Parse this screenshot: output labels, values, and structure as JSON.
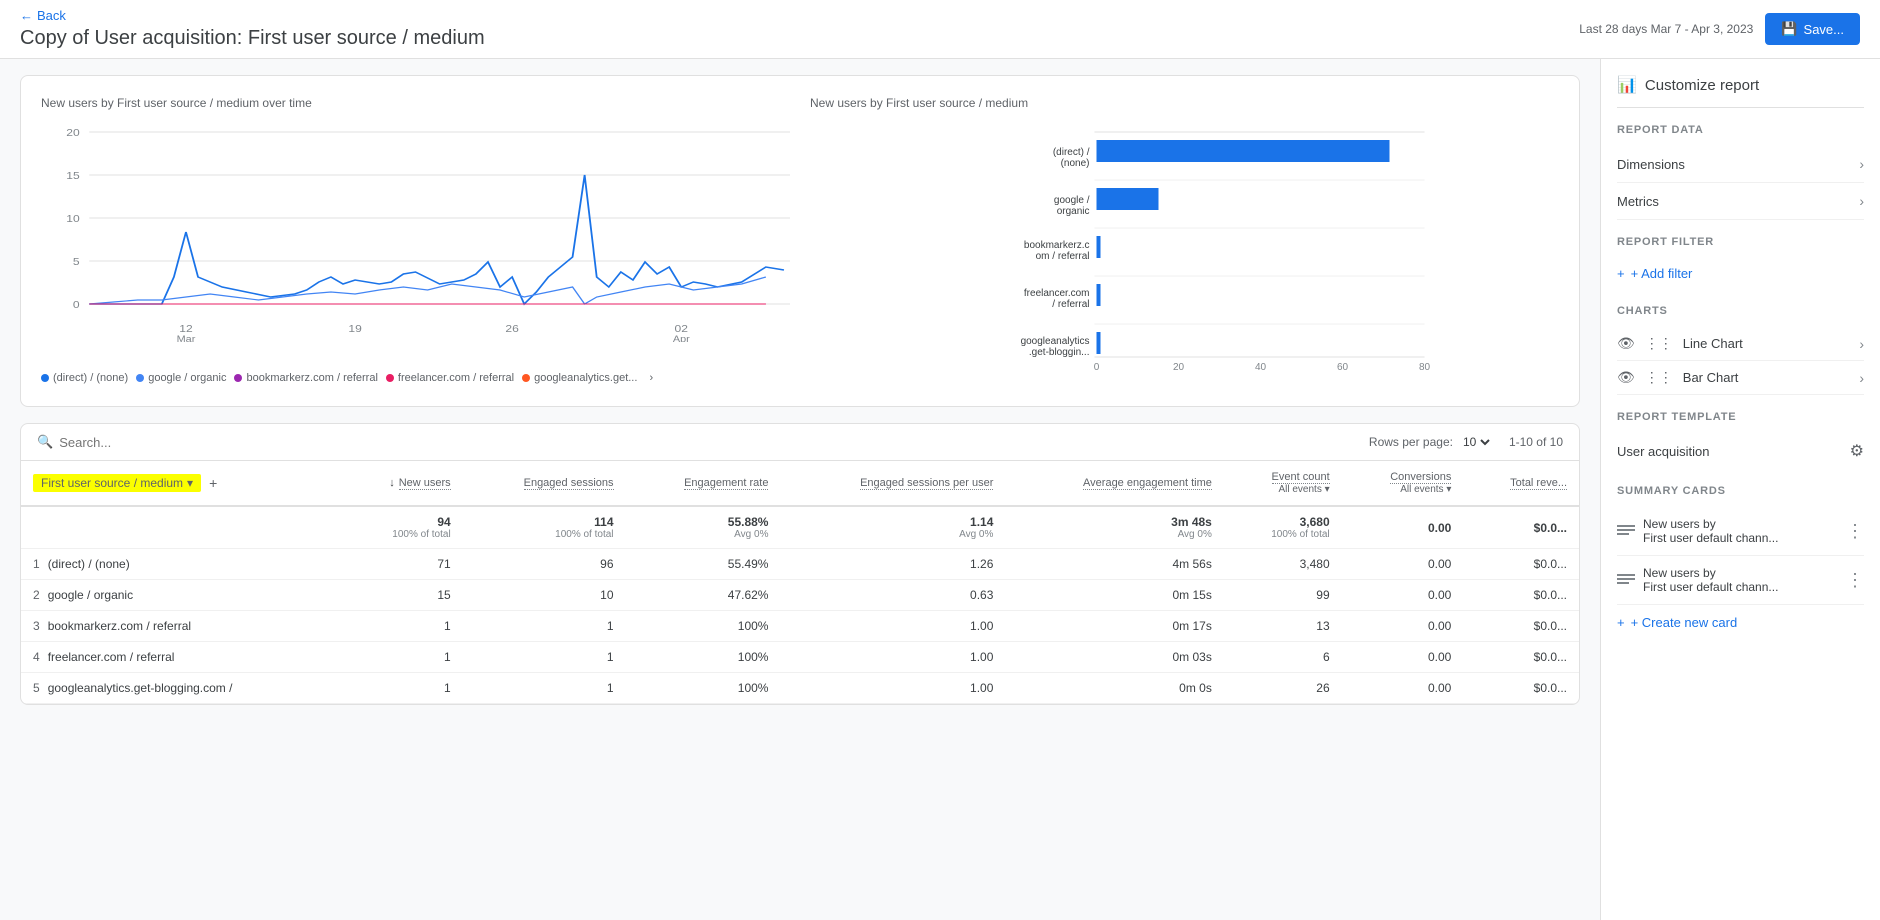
{
  "header": {
    "back_label": "Back",
    "title": "Copy of User acquisition: First user source / medium",
    "date_range_label": "Last 28 days",
    "date_range": "Mar 7 - Apr 3, 2023",
    "save_label": "Save..."
  },
  "line_chart": {
    "title": "New users by First user source / medium over time",
    "x_labels": [
      "12 Mar",
      "19",
      "26",
      "02 Apr"
    ],
    "y_labels": [
      "20",
      "15",
      "10",
      "5",
      "0"
    ],
    "legend": [
      {
        "label": "(direct) / (none)",
        "color": "#1a73e8"
      },
      {
        "label": "google / organic",
        "color": "#4285f4"
      },
      {
        "label": "bookmarkerz.com / referral",
        "color": "#9c27b0"
      },
      {
        "label": "freelancer.com / referral",
        "color": "#e91e63"
      },
      {
        "label": "googleanalytics.get...",
        "color": "#ff5722"
      }
    ]
  },
  "bar_chart": {
    "title": "New users by First user source / medium",
    "categories": [
      {
        "label": "(direct) /\n(none)",
        "value": 71,
        "max": 80
      },
      {
        "label": "google /\norganic",
        "value": 15,
        "max": 80
      },
      {
        "label": "bookmarkerz.c\nom / referral",
        "value": 1,
        "max": 80
      },
      {
        "label": "freelancer.com\n/ referral",
        "value": 1,
        "max": 80
      },
      {
        "label": "googleanalytic\ns.get-bloggin...",
        "value": 1,
        "max": 80
      }
    ],
    "x_labels": [
      "0",
      "20",
      "40",
      "60",
      "80"
    ]
  },
  "table": {
    "search_placeholder": "Search...",
    "rows_per_page_label": "Rows per page:",
    "rows_per_page_value": "10",
    "pagination": "1-10 of 10",
    "dimension_tag": "First user source / medium",
    "columns": [
      {
        "label": "↓ New users",
        "key": "new_users"
      },
      {
        "label": "Engaged sessions",
        "key": "engaged_sessions"
      },
      {
        "label": "Engagement rate",
        "key": "engagement_rate"
      },
      {
        "label": "Engaged sessions per user",
        "key": "engaged_per_user"
      },
      {
        "label": "Average engagement time",
        "key": "avg_engagement"
      },
      {
        "label": "Event count All events ▾",
        "key": "event_count"
      },
      {
        "label": "Conversions All events ▾",
        "key": "conversions"
      },
      {
        "label": "Total reve...",
        "key": "total_revenue"
      }
    ],
    "totals": {
      "new_users": "94",
      "new_users_sub": "100% of total",
      "engaged_sessions": "114",
      "engaged_sessions_sub": "100% of total",
      "engagement_rate": "55.88%",
      "engagement_rate_sub": "Avg 0%",
      "engaged_per_user": "1.14",
      "engaged_per_user_sub": "Avg 0%",
      "avg_engagement": "3m 48s",
      "avg_engagement_sub": "Avg 0%",
      "event_count": "3,680",
      "event_count_sub": "100% of total",
      "conversions": "0.00",
      "total_revenue": "$0.0..."
    },
    "rows": [
      {
        "num": 1,
        "dimension": "(direct) / (none)",
        "new_users": "71",
        "engaged_sessions": "96",
        "engagement_rate": "55.49%",
        "engaged_per_user": "1.26",
        "avg_engagement": "4m 56s",
        "event_count": "3,480",
        "conversions": "0.00",
        "total_revenue": "$0.0..."
      },
      {
        "num": 2,
        "dimension": "google / organic",
        "new_users": "15",
        "engaged_sessions": "10",
        "engagement_rate": "47.62%",
        "engaged_per_user": "0.63",
        "avg_engagement": "0m 15s",
        "event_count": "99",
        "conversions": "0.00",
        "total_revenue": "$0.0..."
      },
      {
        "num": 3,
        "dimension": "bookmarkerz.com / referral",
        "new_users": "1",
        "engaged_sessions": "1",
        "engagement_rate": "100%",
        "engaged_per_user": "1.00",
        "avg_engagement": "0m 17s",
        "event_count": "13",
        "conversions": "0.00",
        "total_revenue": "$0.0..."
      },
      {
        "num": 4,
        "dimension": "freelancer.com / referral",
        "new_users": "1",
        "engaged_sessions": "1",
        "engagement_rate": "100%",
        "engaged_per_user": "1.00",
        "avg_engagement": "0m 03s",
        "event_count": "6",
        "conversions": "0.00",
        "total_revenue": "$0.0..."
      },
      {
        "num": 5,
        "dimension": "googleanalytics.get-blogging.com /",
        "new_users": "1",
        "engaged_sessions": "1",
        "engagement_rate": "100%",
        "engaged_per_user": "1.00",
        "avg_engagement": "0m 0s",
        "event_count": "26",
        "conversions": "0.00",
        "total_revenue": "$0.0..."
      }
    ]
  },
  "right_panel": {
    "customize_title": "Customize report",
    "report_data_title": "REPORT DATA",
    "dimensions_label": "Dimensions",
    "metrics_label": "Metrics",
    "report_filter_title": "REPORT FILTER",
    "add_filter_label": "+ Add filter",
    "charts_title": "CHARTS",
    "line_chart_label": "Line Chart",
    "bar_chart_label": "Bar Chart",
    "report_template_title": "REPORT TEMPLATE",
    "user_acquisition_label": "User acquisition",
    "summary_cards_title": "SUMMARY CARDS",
    "summary_card_1_line1": "New users by",
    "summary_card_1_line2": "First user default chann...",
    "summary_card_2_line1": "New users by",
    "summary_card_2_line2": "First user default chann...",
    "create_card_label": "+ Create new card"
  }
}
